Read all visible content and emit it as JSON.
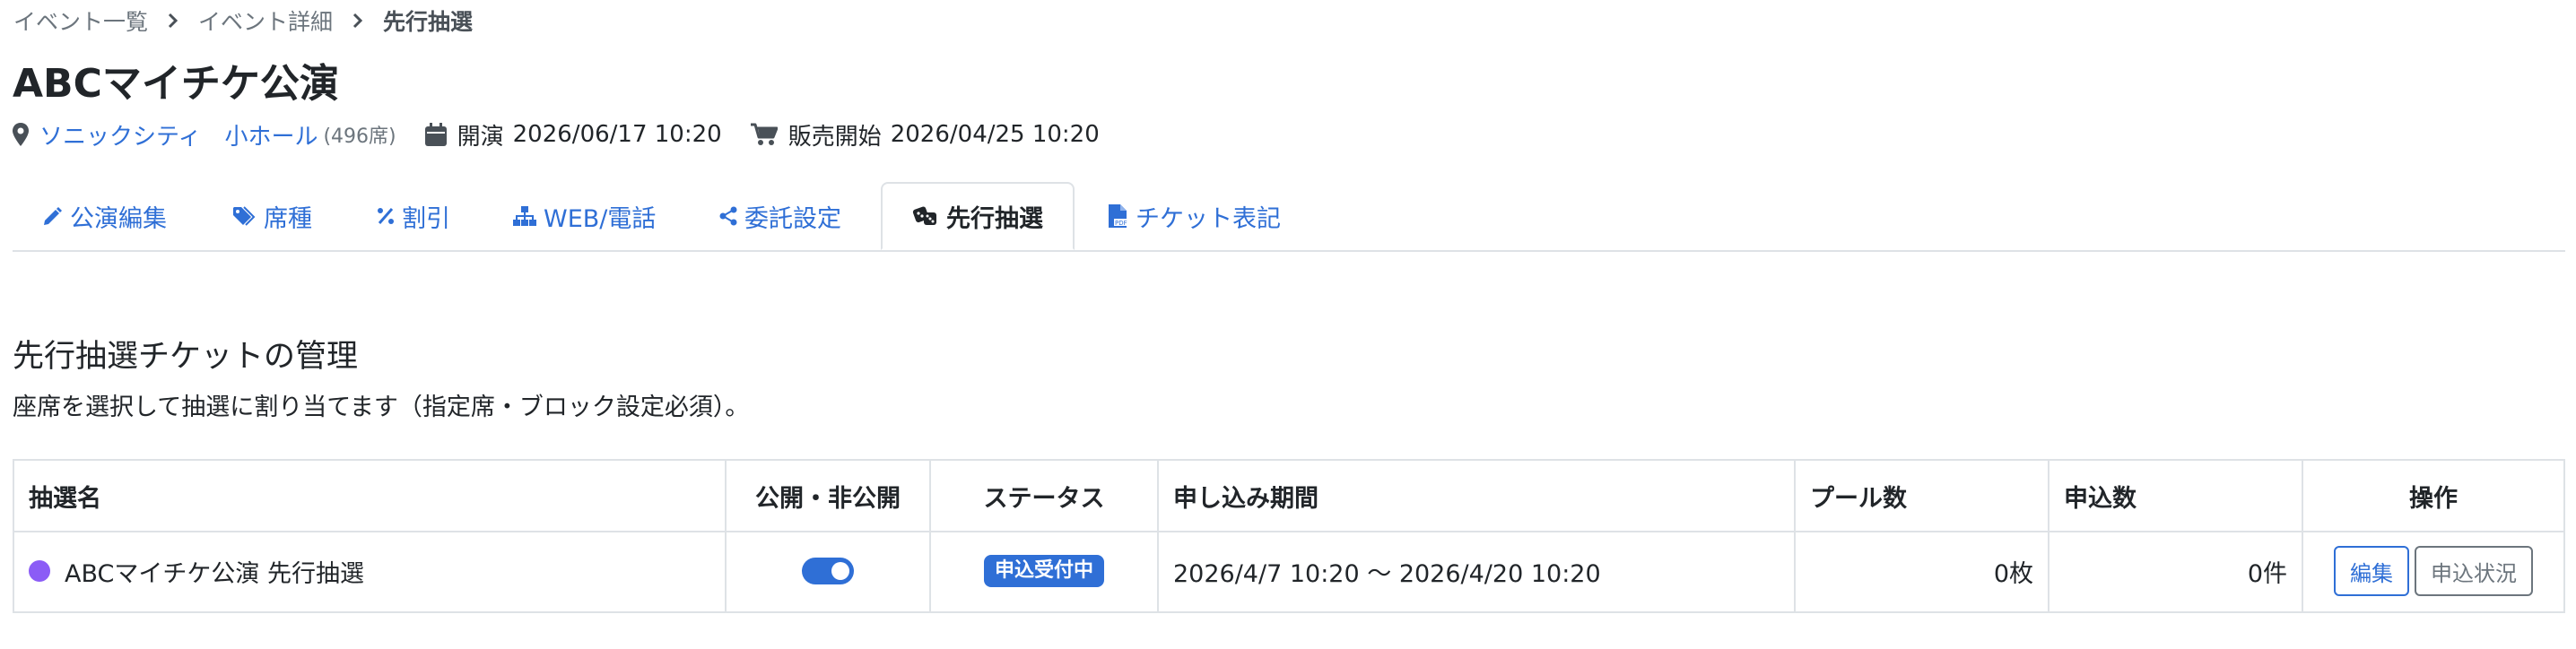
{
  "breadcrumb": {
    "items": [
      "イベント一覧",
      "イベント詳細"
    ],
    "current": "先行抽選"
  },
  "event": {
    "title": "ABCマイチケ公演",
    "venue": "ソニックシティ　小ホール",
    "capacity": "(496席)",
    "open_label": "開演",
    "open_datetime": "2026/06/17 10:20",
    "sale_label": "販売開始",
    "sale_datetime": "2026/04/25 10:20"
  },
  "tabs": [
    {
      "label": "公演編集",
      "icon": "pencil-icon"
    },
    {
      "label": "席種",
      "icon": "tags-icon"
    },
    {
      "label": "割引",
      "icon": "percent-icon"
    },
    {
      "label": "WEB/電話",
      "icon": "sitemap-icon"
    },
    {
      "label": "委託設定",
      "icon": "share-icon"
    },
    {
      "label": "先行抽選",
      "icon": "dice-icon",
      "active": true
    },
    {
      "label": "チケット表記",
      "icon": "file-pdf-icon"
    }
  ],
  "section": {
    "title": "先行抽選チケットの管理",
    "description": "座席を選択して抽選に割り当てます（指定席・ブロック設定必須）。"
  },
  "table": {
    "headers": [
      "抽選名",
      "公開・非公開",
      "ステータス",
      "申し込み期間",
      "プール数",
      "申込数",
      "操作"
    ],
    "rows": [
      {
        "name": "ABCマイチケ公演 先行抽選",
        "dot_color": "#8b5cf6",
        "published": true,
        "status": "申込受付中",
        "period": "2026/4/7 10:20 〜 2026/4/20 10:20",
        "pool": "0枚",
        "applications": "0件",
        "edit_label": "編集",
        "status_label": "申込状況"
      }
    ]
  },
  "colors": {
    "link": "#2f6fd6",
    "primary": "#2f6fd6",
    "badge": "#2f6fd6",
    "toggle_on": "#2f6fd6",
    "muted": "#6c757d",
    "border": "#dee2e6"
  }
}
